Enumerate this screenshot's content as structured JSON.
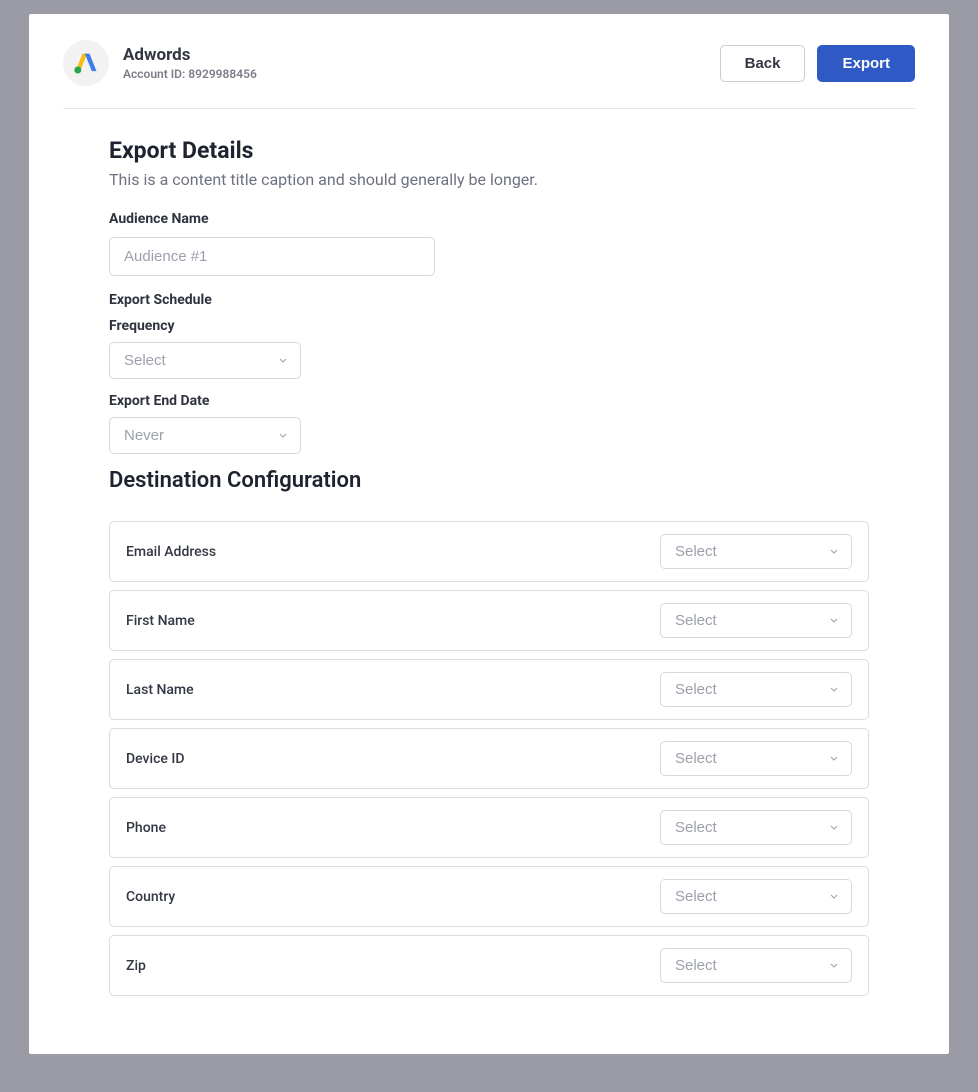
{
  "header": {
    "app_name": "Adwords",
    "account_id_label": "Account ID: 8929988456",
    "back_label": "Back",
    "export_label": "Export"
  },
  "export_details": {
    "title": "Export Details",
    "caption": "This is a content title caption and should generally be longer.",
    "audience_name_label": "Audience Name",
    "audience_name_placeholder": "Audience #1",
    "export_schedule_label": "Export Schedule",
    "frequency_label": "Frequency",
    "frequency_value": "Select",
    "end_date_label": "Export End Date",
    "end_date_value": "Never"
  },
  "destination": {
    "title": "Destination Configuration",
    "select_placeholder": "Select",
    "rows": [
      {
        "label": "Email Address",
        "value": "Select"
      },
      {
        "label": "First Name",
        "value": "Select"
      },
      {
        "label": "Last Name",
        "value": "Select"
      },
      {
        "label": "Device ID",
        "value": "Select"
      },
      {
        "label": "Phone",
        "value": "Select"
      },
      {
        "label": "Country",
        "value": "Select"
      },
      {
        "label": "Zip",
        "value": "Select"
      }
    ]
  }
}
